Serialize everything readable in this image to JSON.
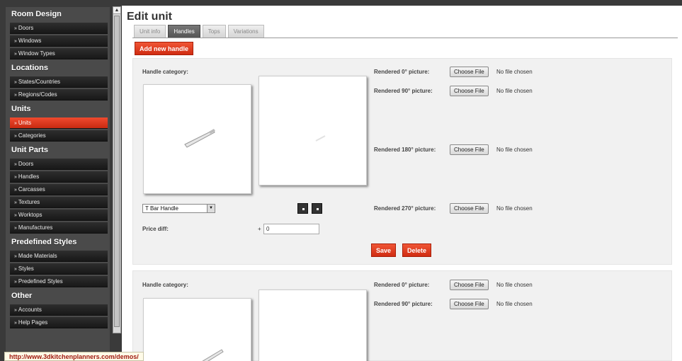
{
  "sidebar": {
    "sections": [
      {
        "heading": "Room Design",
        "items": [
          "Doors",
          "Windows",
          "Window Types"
        ]
      },
      {
        "heading": "Locations",
        "items": [
          "States/Countries",
          "Regions/Codes"
        ]
      },
      {
        "heading": "Units",
        "items": [
          "Units",
          "Categories"
        ]
      },
      {
        "heading": "Unit Parts",
        "items": [
          "Doors",
          "Handles",
          "Carcasses",
          "Textures",
          "Worktops",
          "Manufactures"
        ]
      },
      {
        "heading": "Predefined Styles",
        "items": [
          "Made Materials",
          "Styles",
          "Predefined Styles"
        ]
      },
      {
        "heading": "Other",
        "items": [
          "Accounts",
          "Help Pages"
        ]
      }
    ],
    "active_item": "Units"
  },
  "main": {
    "title": "Edit unit",
    "tabs": [
      "Unit info",
      "Handles",
      "Tops",
      "Variations"
    ],
    "active_tab": "Handles",
    "add_button": "Add new handle",
    "panel1": {
      "category_label": "Handle category:",
      "rendered": [
        {
          "label": "Rendered 0° picture:",
          "button": "Choose File",
          "status": "No file chosen"
        },
        {
          "label": "Rendered 90° picture:",
          "button": "Choose File",
          "status": "No file chosen"
        },
        {
          "label": "Rendered 180° picture:",
          "button": "Choose File",
          "status": "No file chosen"
        },
        {
          "label": "Rendered 270° picture:",
          "button": "Choose File",
          "status": "No file chosen"
        }
      ],
      "select_value": "T Bar Handle",
      "price_label": "Price diff:",
      "price_sign": "+",
      "price_value": "0",
      "save": "Save",
      "delete": "Delete"
    },
    "panel2": {
      "category_label": "Handle category:",
      "rendered": [
        {
          "label": "Rendered 0° picture:",
          "button": "Choose File",
          "status": "No file chosen"
        },
        {
          "label": "Rendered 90° picture:",
          "button": "Choose File",
          "status": "No file chosen"
        }
      ]
    }
  },
  "statusbar": {
    "url": "http://www.3dkitchenplanners.com/demos/"
  }
}
